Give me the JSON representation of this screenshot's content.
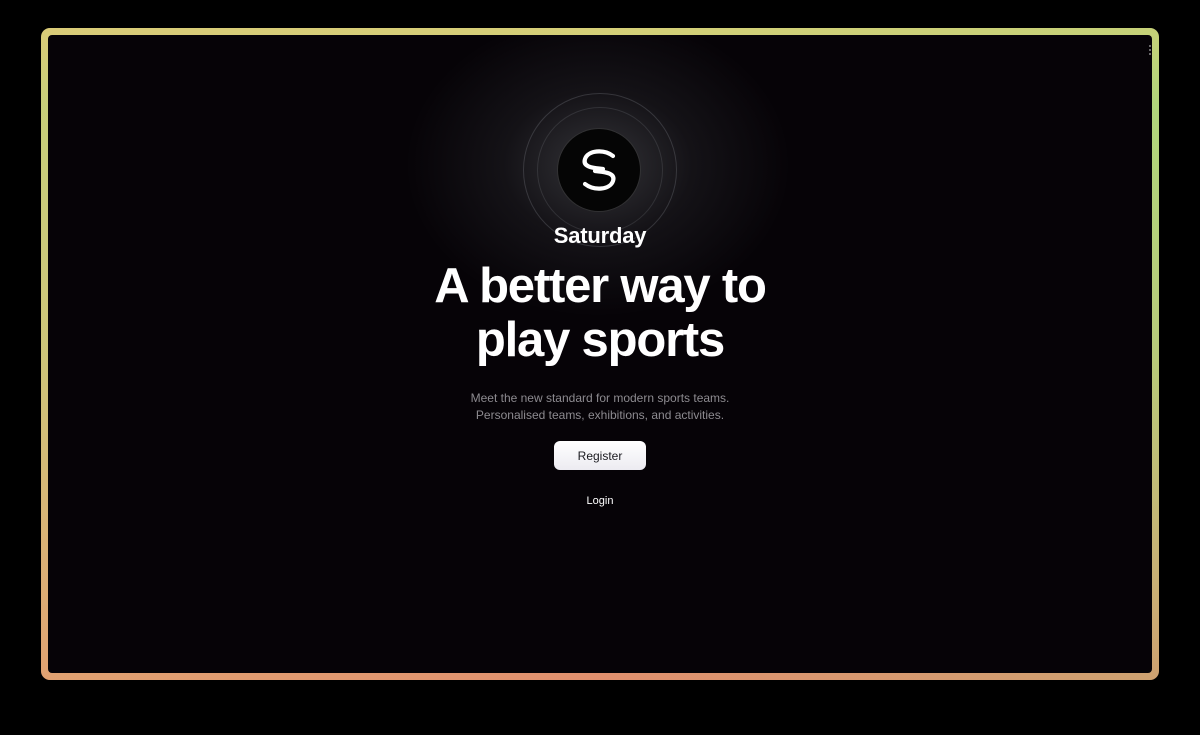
{
  "app": {
    "brand_name": "Saturday",
    "logo_icon": "saturday-logo-icon"
  },
  "hero": {
    "headline_line1": "A better way to",
    "headline_line2": "play sports",
    "subtitle_line1": "Meet the new standard for modern sports teams.",
    "subtitle_line2": "Personalised teams, exhibitions, and activities."
  },
  "actions": {
    "register_label": "Register",
    "login_label": "Login"
  },
  "colors": {
    "background": "#060307",
    "frame_top": "#b9d57c",
    "frame_bottom": "#e08f6e",
    "button_bg": "#f3f2f7",
    "subtitle_text": "#8d8b90"
  }
}
